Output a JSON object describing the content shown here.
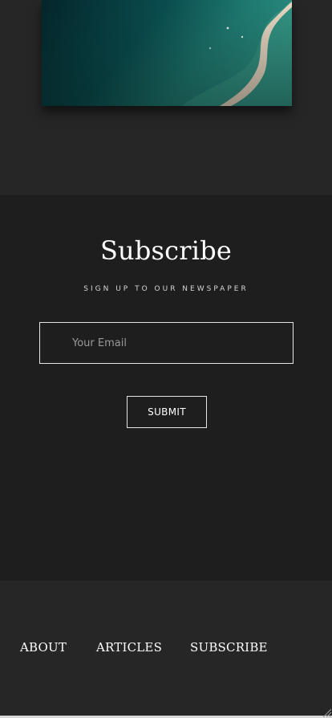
{
  "hero": {
    "image_icon": "aerial-beach-photo"
  },
  "subscribe": {
    "title": "Subscribe",
    "tagline": "SIGN UP TO OUR NEWSPAPER",
    "email_placeholder": "Your Email",
    "email_value": "",
    "submit_label": "SUBMIT"
  },
  "footer": {
    "nav": [
      {
        "label": "ABOUT"
      },
      {
        "label": "ARTICLES"
      },
      {
        "label": "SUBSCRIBE"
      }
    ]
  },
  "colors": {
    "page_bg": "#262626",
    "subscribe_bg": "#1e1e1e",
    "text": "#ffffff",
    "border": "#e6e6e6"
  }
}
